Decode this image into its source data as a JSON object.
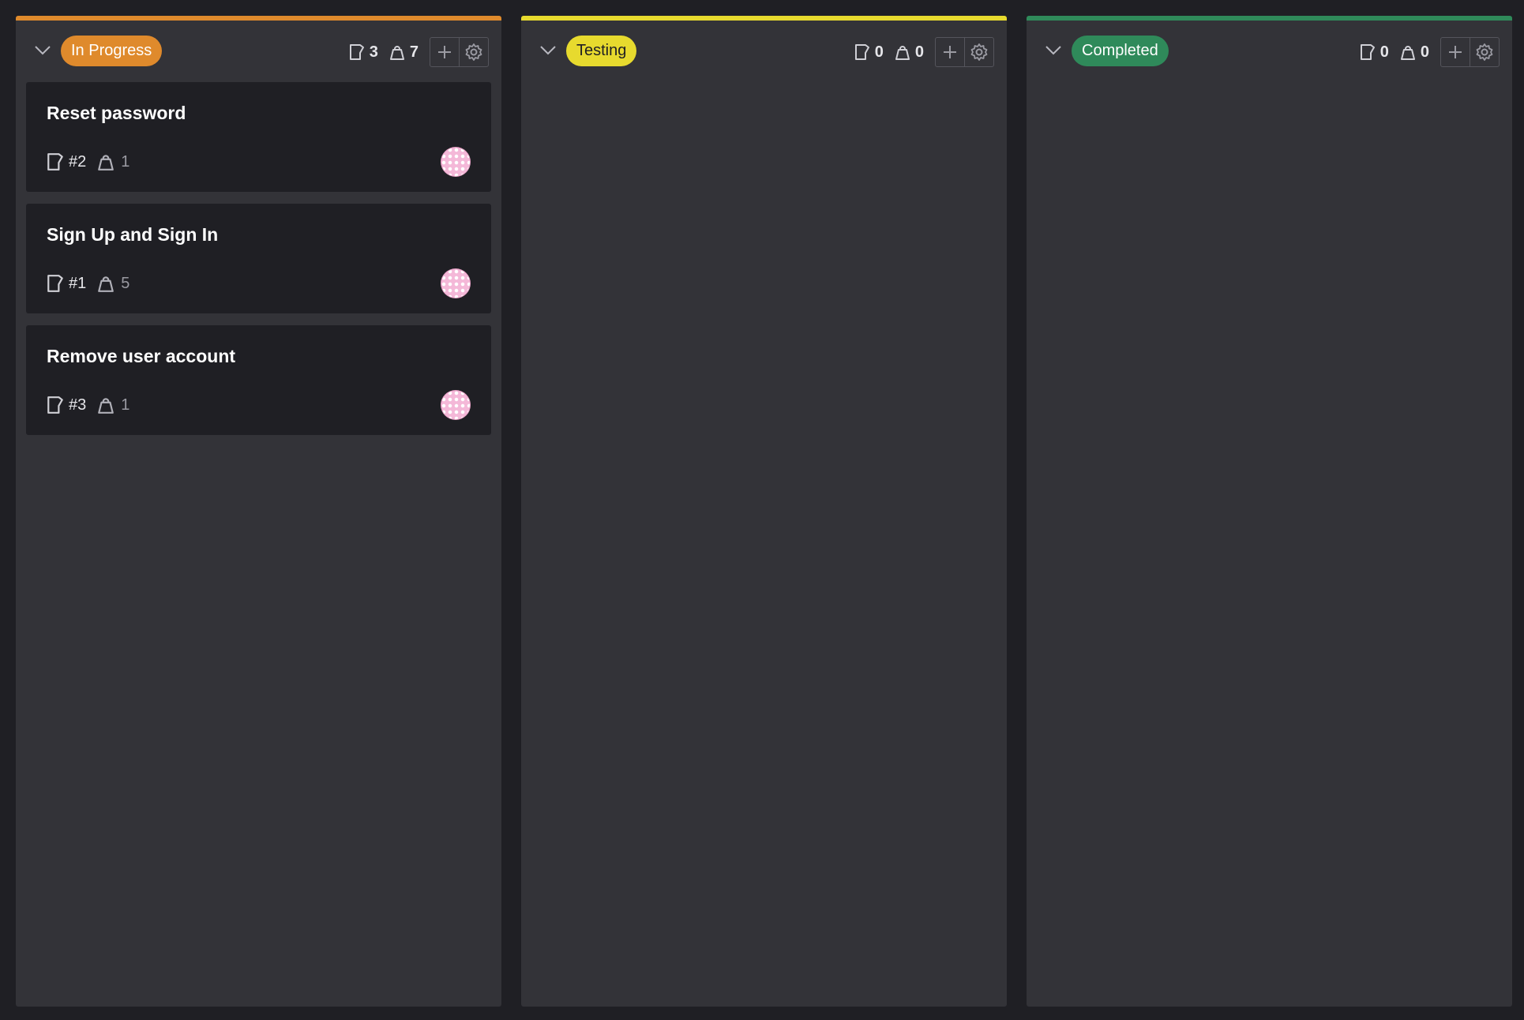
{
  "columns": [
    {
      "name": "In Progress",
      "color": "#df8a2c",
      "text_color": "#ffffff",
      "stats": {
        "stories": "3",
        "points": "7"
      },
      "cards": [
        {
          "title": "Reset password",
          "ref": "#2",
          "points": "1"
        },
        {
          "title": "Sign Up and Sign In",
          "ref": "#1",
          "points": "5"
        },
        {
          "title": "Remove user account",
          "ref": "#3",
          "points": "1"
        }
      ]
    },
    {
      "name": "Testing",
      "color": "#e7da2e",
      "text_color": "#1f1f24",
      "stats": {
        "stories": "0",
        "points": "0"
      },
      "cards": []
    },
    {
      "name": "Completed",
      "color": "#2f8a5a",
      "text_color": "#ffffff",
      "stats": {
        "stories": "0",
        "points": "0"
      },
      "cards": []
    }
  ],
  "icons": {
    "collapse": "chevron-down-icon",
    "story": "story-icon",
    "points": "weight-icon",
    "add": "plus-icon",
    "settings": "gear-icon"
  }
}
